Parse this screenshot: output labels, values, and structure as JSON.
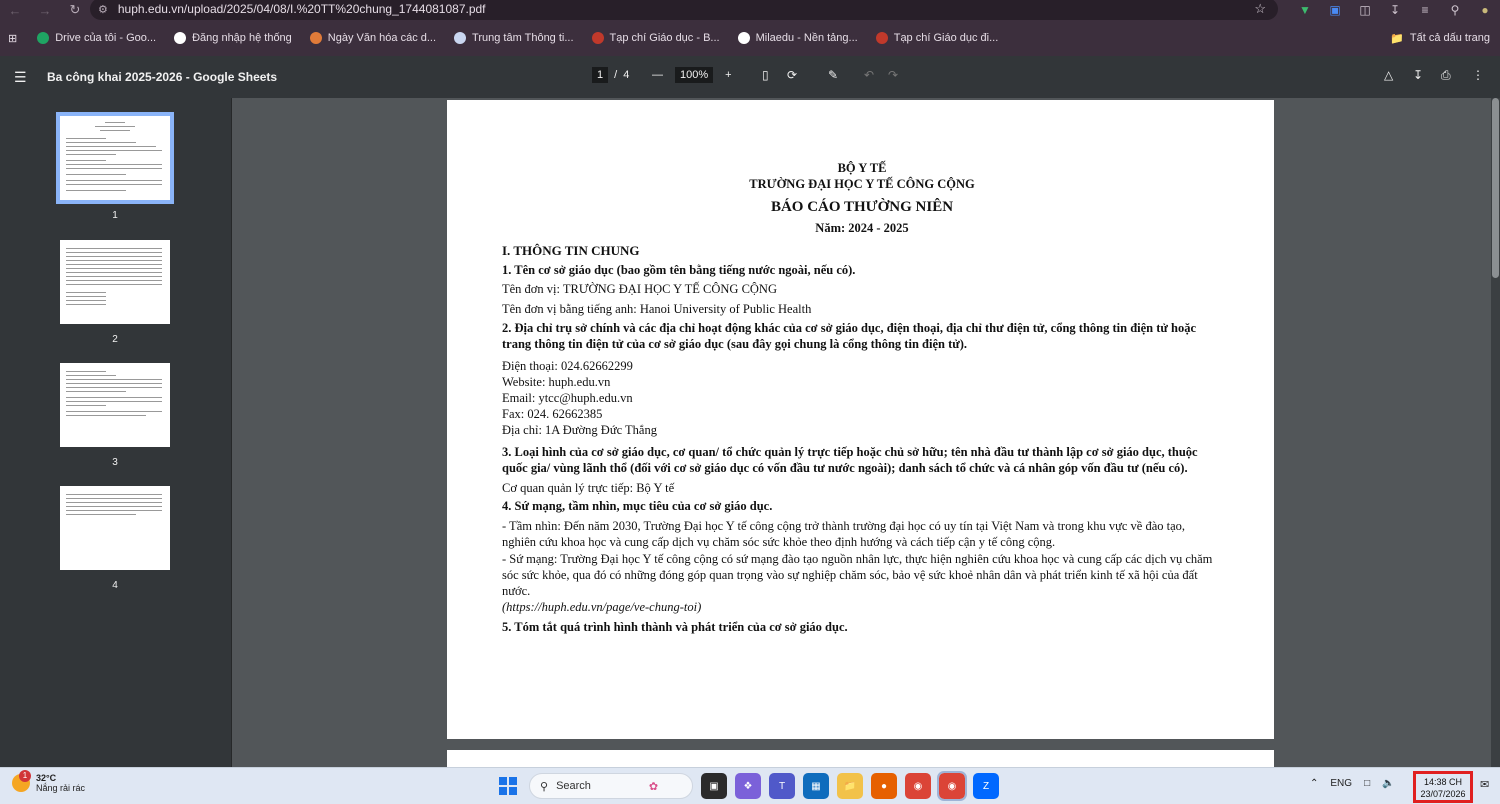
{
  "browser": {
    "url": "huph.edu.vn/upload/2025/04/08/I.%20TT%20chung_1744081087.pdf",
    "bookmarks": [
      "Drive của tôi - Goo...",
      "Đăng nhập hệ thống",
      "Ngày Văn hóa các d...",
      "Trung tâm Thông ti...",
      "Tạp chí Giáo dục - B...",
      "Milaedu - Nền tảng...",
      "Tạp chí Giáo dục đi..."
    ],
    "all_bookmarks": "Tất cả dấu trang"
  },
  "pdf": {
    "title": "Ba công khai 2025-2026 - Google Sheets",
    "current_page": "1",
    "total_pages": "4",
    "page_sep": "/",
    "zoom": "100%",
    "thumb_numbers": [
      "1",
      "2",
      "3",
      "4"
    ]
  },
  "doc": {
    "header1": "BỘ Y TẾ",
    "header2": "TRƯỜNG ĐẠI HỌC Y TẾ CÔNG CỘNG",
    "report_title": "BÁO CÁO THƯỜNG NIÊN",
    "year": "Năm: 2024 - 2025",
    "section1": "I. THÔNG TIN CHUNG",
    "q1": "1. Tên cơ sở giáo dục (bao gồm tên bằng tiếng nước ngoài, nếu có).",
    "name_vi": "Tên đơn vị: TRƯỜNG ĐẠI HỌC Y TẾ CÔNG CỘNG",
    "name_en": "Tên đơn vị bằng tiếng anh: Hanoi University of Public Health",
    "q2": "2. Địa chỉ trụ sở chính và các địa chỉ hoạt động khác của cơ sở giáo dục, điện thoại, địa chỉ thư điện tử, cổng thông tin điện tử hoặc trang thông tin điện tử của cơ sở giáo dục (sau đây gọi chung là cổng thông tin điện tử).",
    "phone": "Điện thoại: 024.62662299",
    "website": "Website: huph.edu.vn",
    "email": "Email: ytcc@huph.edu.vn",
    "fax": "Fax: 024. 62662385",
    "address": "Địa chỉ: 1A Đường Đức Thắng",
    "q3": "3. Loại hình của cơ sở giáo dục, cơ quan/ tổ chức quản lý trực tiếp hoặc chủ sở hữu; tên nhà đầu tư thành lập cơ sở giáo dục, thuộc quốc gia/ vùng lãnh thổ (đối với cơ sở giáo dục có vốn đầu tư nước ngoài); danh sách tổ chức và cá nhân góp vốn đầu tư (nếu có).",
    "agency": "Cơ quan quản lý trực tiếp: Bộ Y tế",
    "q4": "4. Sứ mạng, tầm nhìn, mục tiêu của cơ sở giáo dục.",
    "vision": " - Tầm nhìn: Đến năm 2030, Trường Đại học Y tế công cộng trở thành trường đại học có uy tín tại Việt Nam và trong khu vực về đào tạo, nghiên cứu khoa học và cung cấp dịch vụ chăm sóc sức khỏe theo định hướng và cách tiếp cận y tế công cộng.",
    "mission": " - Sứ mạng: Trường Đại học Y tế công cộng có sứ mạng đào tạo nguồn nhân lực, thực hiện nghiên cứu khoa học và cung cấp các dịch vụ chăm sóc sức khỏe, qua đó có những đóng góp quan trọng vào sự nghiệp chăm sóc, bảo vệ sức khoẻ nhân dân và phát triển kinh tế xã hội của đất nước.",
    "source": "(https://huph.edu.vn/page/ve-chung-toi)",
    "q5": "5. Tóm tắt quá trình hình thành và phát triển của cơ sở giáo dục."
  },
  "taskbar": {
    "temp": "32°C",
    "weather": "Nắng rải rác",
    "weather_badge": "1",
    "search": "Search",
    "lang": "ENG",
    "time": "14:38 CH",
    "date": "23/07/2026"
  }
}
